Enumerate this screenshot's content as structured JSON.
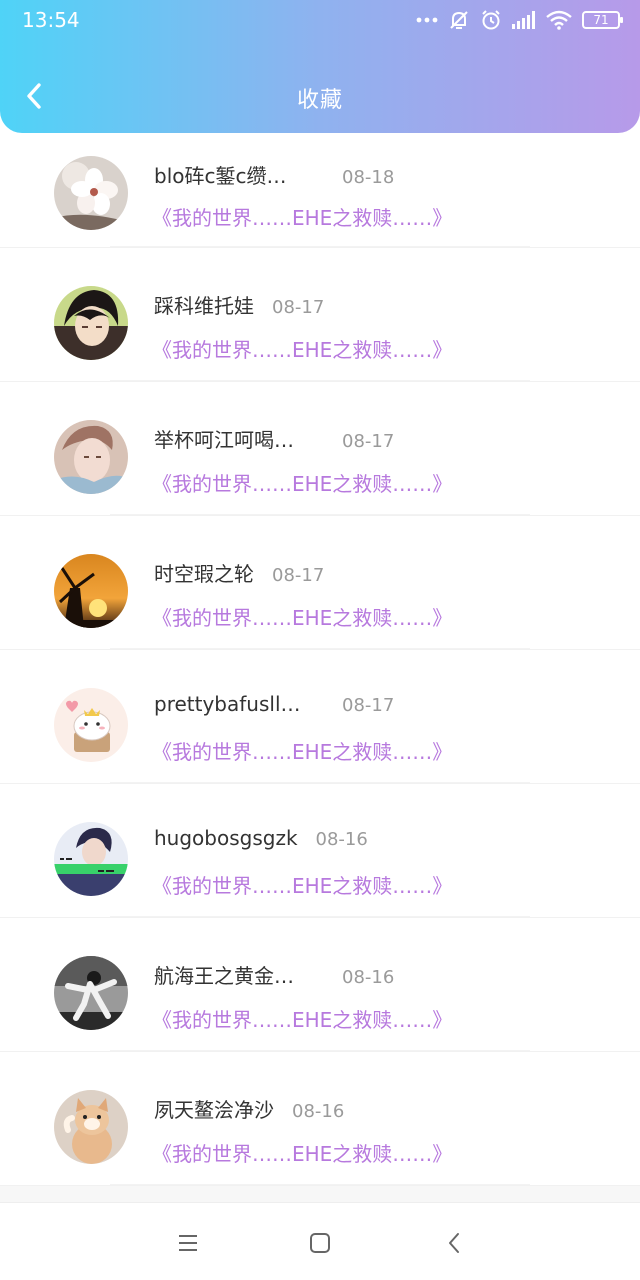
{
  "status_bar": {
    "time": "13:54",
    "battery": "71"
  },
  "header": {
    "title": "收藏"
  },
  "items": [
    {
      "name": "blo砗c錾c缵…",
      "date": "08-18",
      "title": "《我的世界……EHE之救赎……》",
      "avatar": "flower"
    },
    {
      "name": "踩科维托娃",
      "date": "08-17",
      "title": "《我的世界……EHE之救赎……》",
      "avatar": "anime-boy"
    },
    {
      "name": "举杯呵江呵喝…",
      "date": "08-17",
      "title": "《我的世界……EHE之救赎……》",
      "avatar": "portrait"
    },
    {
      "name": "时空瑕之轮",
      "date": "08-17",
      "title": "《我的世界……EHE之救赎……》",
      "avatar": "windmill-sunset"
    },
    {
      "name": "prettybafusll…",
      "date": "08-17",
      "title": "《我的世界……EHE之救赎……》",
      "avatar": "cartoon-cat"
    },
    {
      "name": "hugobosgsgzk",
      "date": "08-16",
      "title": "《我的世界……EHE之救赎……》",
      "avatar": "person-text"
    },
    {
      "name": "航海王之黄金…",
      "date": "08-16",
      "title": "《我的世界……EHE之救赎……》",
      "avatar": "bw-dancer"
    },
    {
      "name": "夙天鳌浍净沙",
      "date": "08-16",
      "title": "《我的世界……EHE之救赎……》",
      "avatar": "kitten"
    }
  ],
  "colors": {
    "accent_purple": "#b779de",
    "gradient_start": "#4fd3f7",
    "gradient_end": "#b79ae9"
  }
}
